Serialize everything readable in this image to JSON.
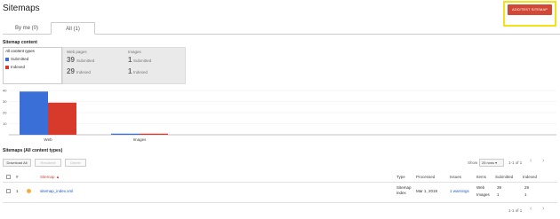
{
  "header": {
    "title": "Sitemaps",
    "add_button": "ADD/TEST SITEMAP"
  },
  "tabs": [
    {
      "label": "By me (0)"
    },
    {
      "label": "All (1)"
    }
  ],
  "content_section": {
    "title": "Sitemap content",
    "filter": {
      "title": "All content types",
      "legend": [
        {
          "label": "Submitted",
          "color": "#3a6fd8"
        },
        {
          "label": "Indexed",
          "color": "#d73a2a"
        }
      ]
    },
    "stats": [
      {
        "header": "Web pages",
        "submitted": "39",
        "submitted_label": "Submitted",
        "indexed": "29",
        "indexed_label": "Indexed"
      },
      {
        "header": "Images",
        "submitted": "1",
        "submitted_label": "Submitted",
        "indexed": "1",
        "indexed_label": "Indexed"
      }
    ]
  },
  "chart_data": {
    "type": "bar",
    "categories": [
      "Web",
      "Images"
    ],
    "series": [
      {
        "name": "Submitted",
        "values": [
          39,
          1
        ],
        "color": "#3a6fd8"
      },
      {
        "name": "Indexed",
        "values": [
          29,
          1
        ],
        "color": "#d73a2a"
      }
    ],
    "yticks": [
      "40",
      "30",
      "20",
      "10"
    ],
    "ylim": [
      0,
      40
    ]
  },
  "table_section": {
    "title": "Sitemaps (All content types)",
    "buttons": {
      "download": "Download All",
      "resubmit": "Resubmit",
      "delete": "Delete"
    },
    "show_label": "Show",
    "rows_select": "25 rows",
    "pagination_top": "1-1 of 1",
    "pagination_bottom": "1-1 of 1",
    "columns": {
      "num": "#",
      "sitemap": "Sitemap ▲",
      "type": "Type",
      "processed": "Processed",
      "issues": "Issues",
      "items": "Items",
      "submitted": "Submitted",
      "indexed": "Indexed"
    },
    "rows": [
      {
        "num": "1",
        "sitemap": "sitemap_index.xml",
        "type_line1": "Sitemap",
        "type_line2": "index",
        "processed": "Mar 1, 2018",
        "issues": "1 warnings",
        "items": [
          "Web",
          "Images"
        ],
        "submitted": [
          "39",
          "1"
        ],
        "indexed": [
          "29",
          "1"
        ]
      }
    ]
  }
}
